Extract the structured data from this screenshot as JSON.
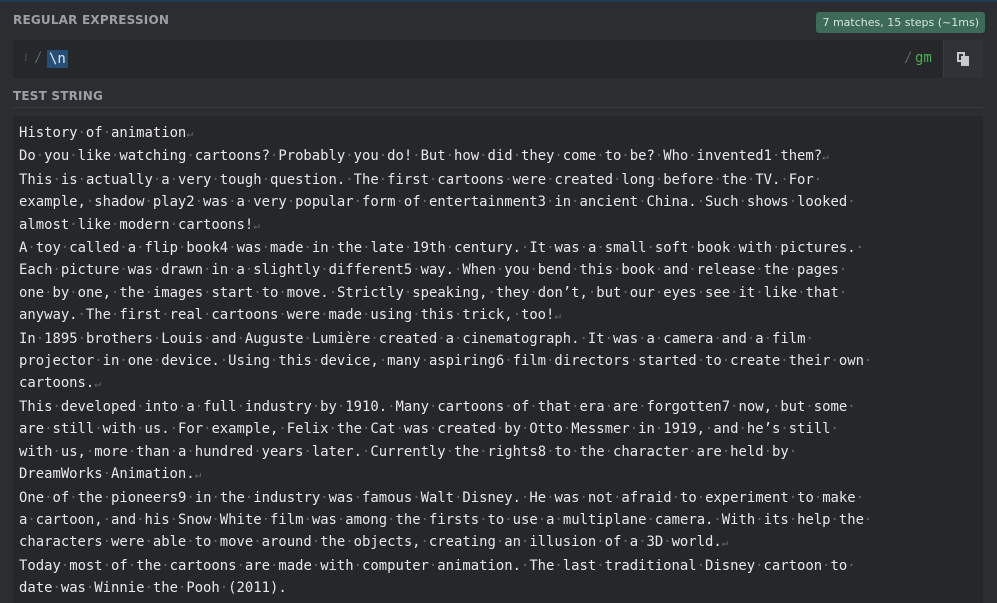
{
  "regex": {
    "label": "REGULAR EXPRESSION",
    "delimiter_open": "/",
    "pattern": "\\n",
    "delimiter_close": "/",
    "flags": "gm",
    "match_info": "7 matches, 15 steps (~1ms)"
  },
  "test": {
    "label": "TEST STRING",
    "lines": [
      {
        "text": "History of animation",
        "nl": true
      },
      {
        "text": "Do you like watching cartoons? Probably you do! But how did they come to be? Who invented1 them?",
        "nl": true
      },
      {
        "text": "This is actually a very tough question. The first cartoons were created long before the TV. For ",
        "nl": false
      },
      {
        "text": "example, shadow play2 was a very popular form of entertainment3 in ancient China. Such shows looked ",
        "nl": false
      },
      {
        "text": "almost like modern cartoons!",
        "nl": true
      },
      {
        "text": "A toy called a flip book4 was made in the late 19th century. It was a small soft book with pictures. ",
        "nl": false
      },
      {
        "text": "Each picture was drawn in a slightly different5 way. When you bend this book and release the pages ",
        "nl": false
      },
      {
        "text": "one by one, the images start to move. Strictly speaking, they don’t, but our eyes see it like that ",
        "nl": false
      },
      {
        "text": "anyway. The first real cartoons were made using this trick, too!",
        "nl": true
      },
      {
        "text": "In 1895 brothers Louis and Auguste Lumière created a cinematograph. It was a camera and a film ",
        "nl": false
      },
      {
        "text": "projector in one device. Using this device, many aspiring6 film directors started to create their own ",
        "nl": false
      },
      {
        "text": "cartoons.",
        "nl": true
      },
      {
        "text": "This developed into a full industry by 1910. Many cartoons of that era are forgotten7 now, but some ",
        "nl": false
      },
      {
        "text": "are still with us. For example, Felix the Cat was created by Otto Messmer in 1919, and he’s still ",
        "nl": false
      },
      {
        "text": "with us, more than a hundred years later. Currently the rights8 to the character are held by ",
        "nl": false
      },
      {
        "text": "DreamWorks Animation.",
        "nl": true
      },
      {
        "text": "One of the pioneers9 in the industry was famous Walt Disney. He was not afraid to experiment to make ",
        "nl": false
      },
      {
        "text": "a cartoon, and his Snow White film was among the firsts to use a multiplane camera. With its help the ",
        "nl": false
      },
      {
        "text": "characters were able to move around the objects, creating an illusion of a 3D world.",
        "nl": true
      },
      {
        "text": "Today most of the cartoons are made with computer animation. The last traditional Disney cartoon to ",
        "nl": false
      },
      {
        "text": "date was Winnie the Pooh (2011).",
        "nl": false
      }
    ]
  },
  "icons": {
    "grip": "drag-grip-icon",
    "copy": "copy-icon",
    "whitespace": "middle-dot",
    "newline": "return-arrow"
  },
  "colors": {
    "background": "#2b2d30",
    "panel": "#25272a",
    "badge": "#3e6b58",
    "selection": "#264f78",
    "flags": "#4caf50"
  }
}
